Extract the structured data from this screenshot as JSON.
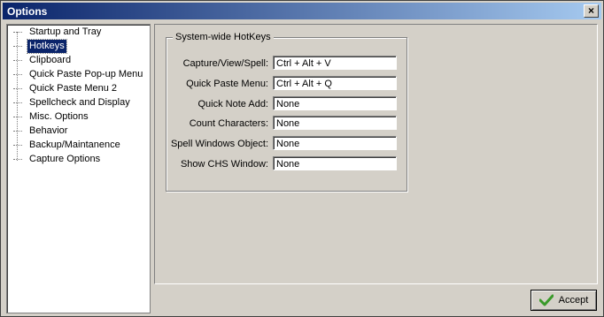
{
  "window": {
    "title": "Options",
    "close_glyph": "×"
  },
  "tree": {
    "items": [
      {
        "label": "Startup and Tray",
        "selected": false
      },
      {
        "label": "Hotkeys",
        "selected": true
      },
      {
        "label": "Clipboard",
        "selected": false
      },
      {
        "label": "Quick Paste Pop-up Menu",
        "selected": false
      },
      {
        "label": "Quick Paste Menu 2",
        "selected": false
      },
      {
        "label": "Spellcheck and Display",
        "selected": false
      },
      {
        "label": "Misc. Options",
        "selected": false
      },
      {
        "label": "Behavior",
        "selected": false
      },
      {
        "label": "Backup/Maintanence",
        "selected": false
      },
      {
        "label": "Capture Options",
        "selected": false
      }
    ]
  },
  "hotkeys": {
    "group_title": "System-wide HotKeys",
    "rows": [
      {
        "label": "Capture/View/Spell:",
        "value": "Ctrl + Alt + V"
      },
      {
        "label": "Quick Paste Menu:",
        "value": "Ctrl + Alt + Q"
      },
      {
        "label": "Quick Note Add:",
        "value": "None"
      },
      {
        "label": "Count Characters:",
        "value": "None"
      },
      {
        "label": "Spell Windows Object:",
        "value": "None"
      },
      {
        "label": "Show CHS Window:",
        "value": "None"
      }
    ]
  },
  "buttons": {
    "accept_label": "Accept",
    "accept_icon": "checkmark-icon"
  },
  "colors": {
    "selection": "#0a246a",
    "titlebar_start": "#0a246a",
    "titlebar_end": "#a6caf0",
    "checkmark": "#3a9a2a"
  }
}
